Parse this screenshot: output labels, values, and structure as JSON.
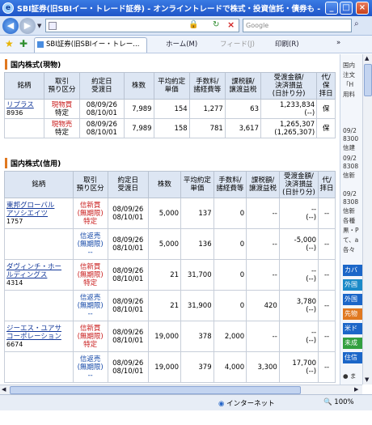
{
  "window": {
    "title": "SBI証券(旧SBIイー・トレード証券) - オンライントレードで株式・投資信託・債券も - Windo...",
    "min": "_",
    "max": "□",
    "close": "×"
  },
  "addressbar": {
    "search_placeholder": "Google",
    "search_icon": "search-icon"
  },
  "commandbar": {
    "tab_label": "SBI証券(旧SBIイー・トレー...",
    "home": "ホーム(M)",
    "feed": "フィード(J)",
    "print": "印刷(R)",
    "page": "»"
  },
  "spot": {
    "title": "国内株式(現物)",
    "headers": [
      "銘柄",
      "取引\n預り区分",
      "約定日\n受渡日",
      "株数",
      "平均約定\n単価",
      "手数料/\n諸経費等",
      "課税額/\n譲渡益税",
      "受渡金額/\n決済損益\n(日計り分)",
      "代/\n保\n拝日"
    ],
    "rows": [
      {
        "name": "リプラス",
        "code": "8936",
        "trade": "現物買",
        "acct": "特定",
        "date1": "08/09/26",
        "date2": "08/10/01",
        "qty": "7,989",
        "price": "154",
        "fee": "1,277",
        "tax": "63",
        "amount": "1,233,834",
        "pl": "(--)",
        "last": "保"
      },
      {
        "name": "",
        "code": "",
        "trade": "現物売",
        "acct": "特定",
        "date1": "08/09/26",
        "date2": "08/10/01",
        "qty": "7,989",
        "price": "158",
        "fee": "781",
        "tax": "3,617",
        "amount": "1,265,307",
        "pl": "(1,265,307)",
        "last": "保"
      }
    ]
  },
  "margin": {
    "title": "国内株式(信用)",
    "headers": [
      "銘柄",
      "取引\n預り区分",
      "約定日\n受渡日",
      "株数",
      "平均約定\n単価",
      "手数料/\n諸経費等",
      "課税額/\n譲渡益税",
      "受渡金額/\n決済損益\n(日計り分)",
      "代/\n拝日"
    ],
    "rows": [
      {
        "name": "東邦グローバル\nアソシエイツ",
        "code": "1757",
        "trade": "信新買\n(無期限)\n特定",
        "date1": "08/09/26",
        "date2": "08/10/01",
        "qty": "5,000",
        "price": "137",
        "fee": "0",
        "tax": "--",
        "amount": "--",
        "pl": "(--)",
        "last": "--",
        "tagcolor": "red"
      },
      {
        "name": "",
        "code": "",
        "trade": "信返売\n(無期限)\n--",
        "date1": "08/09/26",
        "date2": "08/10/01",
        "qty": "5,000",
        "price": "136",
        "fee": "0",
        "tax": "--",
        "amount": "-5,000",
        "pl": "(--)",
        "last": "--",
        "tagcolor": "blue"
      },
      {
        "name": "ダヴィンチ・ホー\nルディングス",
        "code": "4314",
        "trade": "信新買\n(無期限)\n特定",
        "date1": "08/09/26",
        "date2": "08/10/01",
        "qty": "21",
        "price": "31,700",
        "fee": "0",
        "tax": "--",
        "amount": "--",
        "pl": "(--)",
        "last": "--",
        "tagcolor": "red"
      },
      {
        "name": "",
        "code": "",
        "trade": "信返売\n(無期限)\n--",
        "date1": "08/09/26",
        "date2": "08/10/01",
        "qty": "21",
        "price": "31,900",
        "fee": "0",
        "tax": "420",
        "amount": "3,780",
        "pl": "(--)",
        "last": "--",
        "tagcolor": "blue"
      },
      {
        "name": "ジーエス・ユアサ\nコーポレーション",
        "code": "6674",
        "trade": "信新買\n(無期限)\n特定",
        "date1": "08/09/26",
        "date2": "08/10/01",
        "qty": "19,000",
        "price": "378",
        "fee": "2,000",
        "tax": "--",
        "amount": "--",
        "pl": "(--)",
        "last": "--",
        "tagcolor": "red"
      },
      {
        "name": "",
        "code": "",
        "trade": "信返売\n(無期限)\n--",
        "date1": "08/09/26",
        "date2": "08/10/01",
        "qty": "19,000",
        "price": "379",
        "fee": "4,000",
        "tax": "3,300",
        "amount": "17,700",
        "pl": "(--)",
        "last": "--",
        "tagcolor": "blue"
      }
    ]
  },
  "sidebar": {
    "texts": [
      "国内",
      "注文",
      "「H",
      "用料",
      "09/2",
      "8300",
      "信建",
      "09/2",
      "8308",
      "信新",
      "09/2",
      "8308",
      "信新",
      "各種",
      "黒・P",
      "て、a",
      "各々"
    ],
    "buttons": [
      {
        "label": "カバ",
        "color": "#1b66c8"
      },
      {
        "label": "外国",
        "color": "#1b8ac8"
      },
      {
        "label": "外国",
        "color": "#1b66c8"
      },
      {
        "label": "先物",
        "color": "#e07820"
      },
      {
        "label": "米ド",
        "color": "#1b66c8"
      },
      {
        "label": "未成",
        "color": "#33a040"
      },
      {
        "label": "住信",
        "color": "#1b66c8"
      }
    ],
    "bottom": "● ま"
  },
  "status": {
    "zone": "インターネット",
    "zoom": "100%"
  }
}
